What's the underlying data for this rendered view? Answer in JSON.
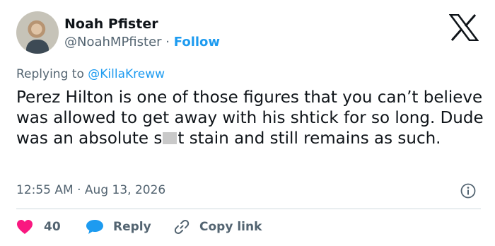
{
  "user": {
    "name": "Noah Pfister",
    "handle": "@NoahMPfister",
    "separator": "·",
    "follow_label": "Follow"
  },
  "reply_context": {
    "prefix": "Replying to ",
    "mention": "@KillaKreww"
  },
  "tweet": {
    "text_part1": "Perez Hilton is one of those figures that you can’t believe was allowed to get away with his shtick for so long. Dude was an absolute s",
    "text_part2": "t stain and still remains as such."
  },
  "meta": {
    "time": "12:55 AM",
    "separator": "·",
    "date": "Aug 13, 2026"
  },
  "actions": {
    "like_count": "40",
    "reply_label": "Reply",
    "copy_label": "Copy link"
  },
  "colors": {
    "like": "#f91880",
    "reply": "#1d9bf0",
    "link": "#1d9bf0",
    "secondary_text": "#536471"
  },
  "icons": {
    "brand": "x-logo-icon",
    "info": "info-icon",
    "like": "heart-icon",
    "reply": "speech-bubble-icon",
    "copy": "link-icon"
  }
}
